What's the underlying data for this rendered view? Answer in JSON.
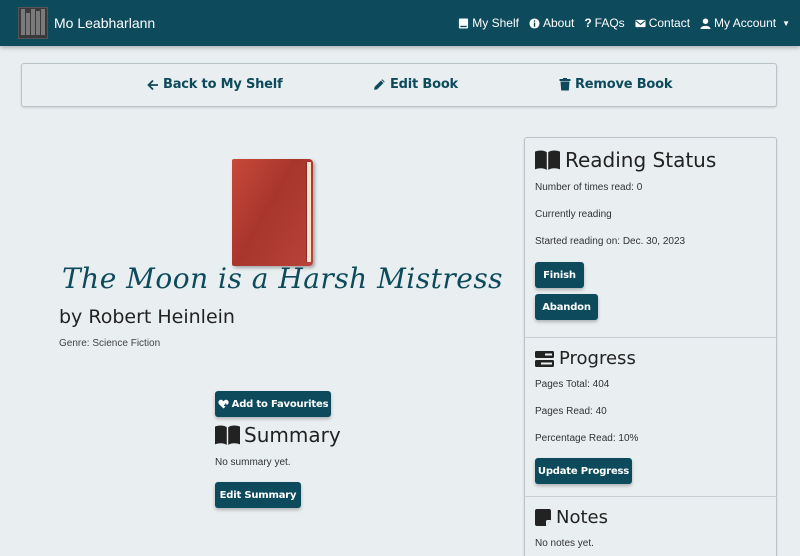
{
  "navbar": {
    "brand": "Mo Leabharlann",
    "links": [
      {
        "label": "My Shelf",
        "icon": "book-icon"
      },
      {
        "label": "About",
        "icon": "info-icon"
      },
      {
        "label": "FAQs",
        "icon": "question-icon"
      },
      {
        "label": "Contact",
        "icon": "envelope-icon"
      },
      {
        "label": "My Account",
        "icon": "user-icon"
      }
    ],
    "bg_color": "#0d4a5c"
  },
  "actions": {
    "back": "Back to My Shelf",
    "edit": "Edit Book",
    "remove": "Remove Book"
  },
  "book": {
    "title": "The Moon is a Harsh Mistress",
    "author": "by Robert Heinlein",
    "genre": "Genre: Science Fiction",
    "cover_color": "#b23c30"
  },
  "favourites_label": "Add to Favourites",
  "summary": {
    "heading": "Summary",
    "text": "No summary yet.",
    "edit_label": "Edit Summary"
  },
  "reading_status": {
    "heading": "Reading Status",
    "times_read": "Number of times read: 0",
    "state": "Currently reading",
    "started": "Started reading on: Dec. 30, 2023",
    "finish_label": "Finish",
    "abandon_label": "Abandon"
  },
  "progress": {
    "heading": "Progress",
    "pages_total": "Pages Total: 404",
    "pages_read": "Pages Read: 40",
    "percentage": "Percentage Read: 10%",
    "update_label": "Update Progress"
  },
  "notes": {
    "heading": "Notes",
    "text": "No notes yet."
  },
  "accent_color": "#0d4a5c"
}
